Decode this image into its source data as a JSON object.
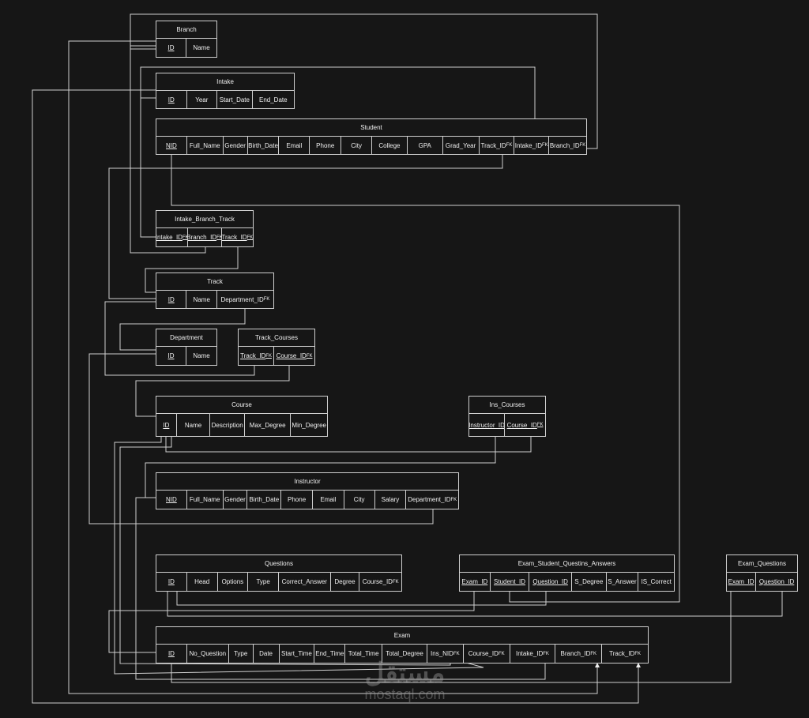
{
  "diagram": {
    "line_color": "#cfcfcf",
    "background": "#161616",
    "entities": [
      {
        "id": "branch",
        "name": "Branch",
        "fields": [
          {
            "label": "ID",
            "pk": true
          },
          {
            "label": "Name"
          }
        ]
      },
      {
        "id": "intake",
        "name": "Intake",
        "fields": [
          {
            "label": "ID",
            "pk": true
          },
          {
            "label": "Year"
          },
          {
            "label": "Start_Date"
          },
          {
            "label": "End_Date"
          }
        ]
      },
      {
        "id": "student",
        "name": "Student",
        "fields": [
          {
            "label": "NID",
            "pk": true
          },
          {
            "label": "Full_Name"
          },
          {
            "label": "Gender"
          },
          {
            "label": "Birth_Date"
          },
          {
            "label": "Email"
          },
          {
            "label": "Phone"
          },
          {
            "label": "City"
          },
          {
            "label": "College"
          },
          {
            "label": "GPA"
          },
          {
            "label": "Grad_Year"
          },
          {
            "label": "Track_ID",
            "fk": true
          },
          {
            "label": "Intake_ID",
            "fk": true
          },
          {
            "label": "Branch_ID",
            "fk": true
          }
        ]
      },
      {
        "id": "intake_branch_track",
        "name": "Intake_Branch_Track",
        "fields": [
          {
            "label": "Intake_ID",
            "fk": true,
            "pk": true
          },
          {
            "label": "Branch_ID",
            "fk": true,
            "pk": true
          },
          {
            "label": "Track_ID",
            "fk": true,
            "pk": true
          }
        ]
      },
      {
        "id": "track",
        "name": "Track",
        "fields": [
          {
            "label": "ID",
            "pk": true
          },
          {
            "label": "Name"
          },
          {
            "label": "Department_ID",
            "fk": true
          }
        ]
      },
      {
        "id": "department",
        "name": "Department",
        "fields": [
          {
            "label": "ID",
            "pk": true
          },
          {
            "label": "Name"
          }
        ]
      },
      {
        "id": "track_courses",
        "name": "Track_Courses",
        "fields": [
          {
            "label": "Track_ID",
            "fk": true,
            "pk": true
          },
          {
            "label": "Course_ID",
            "fk": true,
            "pk": true
          }
        ]
      },
      {
        "id": "course",
        "name": "Course",
        "fields": [
          {
            "label": "ID",
            "pk": true
          },
          {
            "label": "Name"
          },
          {
            "label": "Description"
          },
          {
            "label": "Max_Degree"
          },
          {
            "label": "Min_Degree"
          }
        ]
      },
      {
        "id": "ins_courses",
        "name": "Ins_Courses",
        "fields": [
          {
            "label": "Instructor_ID",
            "pk": true
          },
          {
            "label": "Course_ID",
            "fk": true,
            "pk": true
          }
        ]
      },
      {
        "id": "instructor",
        "name": "Instructor",
        "fields": [
          {
            "label": "NID",
            "pk": true
          },
          {
            "label": "Full_Name"
          },
          {
            "label": "Gender"
          },
          {
            "label": "Birth_Date"
          },
          {
            "label": "Phone"
          },
          {
            "label": "Email"
          },
          {
            "label": "City"
          },
          {
            "label": "Salary"
          },
          {
            "label": "Department_ID",
            "fk": true
          }
        ]
      },
      {
        "id": "questions",
        "name": "Questions",
        "fields": [
          {
            "label": "ID",
            "pk": true
          },
          {
            "label": "Head"
          },
          {
            "label": "Options"
          },
          {
            "label": "Type"
          },
          {
            "label": "Correct_Answer"
          },
          {
            "label": "Degree"
          },
          {
            "label": "Course_ID",
            "fk": true
          }
        ]
      },
      {
        "id": "esqa",
        "name": "Exam_Student_Questins_Answers",
        "fields": [
          {
            "label": "Exam_ID",
            "pk": true
          },
          {
            "label": "Student_ID",
            "pk": true
          },
          {
            "label": "Question_ID",
            "pk": true
          },
          {
            "label": "S_Degree"
          },
          {
            "label": "S_Answer"
          },
          {
            "label": "IS_Correct"
          }
        ]
      },
      {
        "id": "exam_questions",
        "name": "Exam_Questions",
        "fields": [
          {
            "label": "Exam_ID",
            "pk": true
          },
          {
            "label": "Question_ID",
            "pk": true
          }
        ]
      },
      {
        "id": "exam",
        "name": "Exam",
        "fields": [
          {
            "label": "ID",
            "pk": true
          },
          {
            "label": "No_Question"
          },
          {
            "label": "Type"
          },
          {
            "label": "Date"
          },
          {
            "label": "Start_Time"
          },
          {
            "label": "End_Time"
          },
          {
            "label": "Total_Time"
          },
          {
            "label": "Total_Degree"
          },
          {
            "label": "Ins_NID",
            "fk": true
          },
          {
            "label": "Course_ID",
            "fk": true
          },
          {
            "label": "Intake_ID",
            "fk": true
          },
          {
            "label": "Branch_ID",
            "fk": true
          },
          {
            "label": "Track_ID",
            "fk": true
          }
        ]
      }
    ],
    "fk_suffix": "FK"
  },
  "watermark": {
    "arabic": "مستقل",
    "latin": "mostaql.com"
  }
}
